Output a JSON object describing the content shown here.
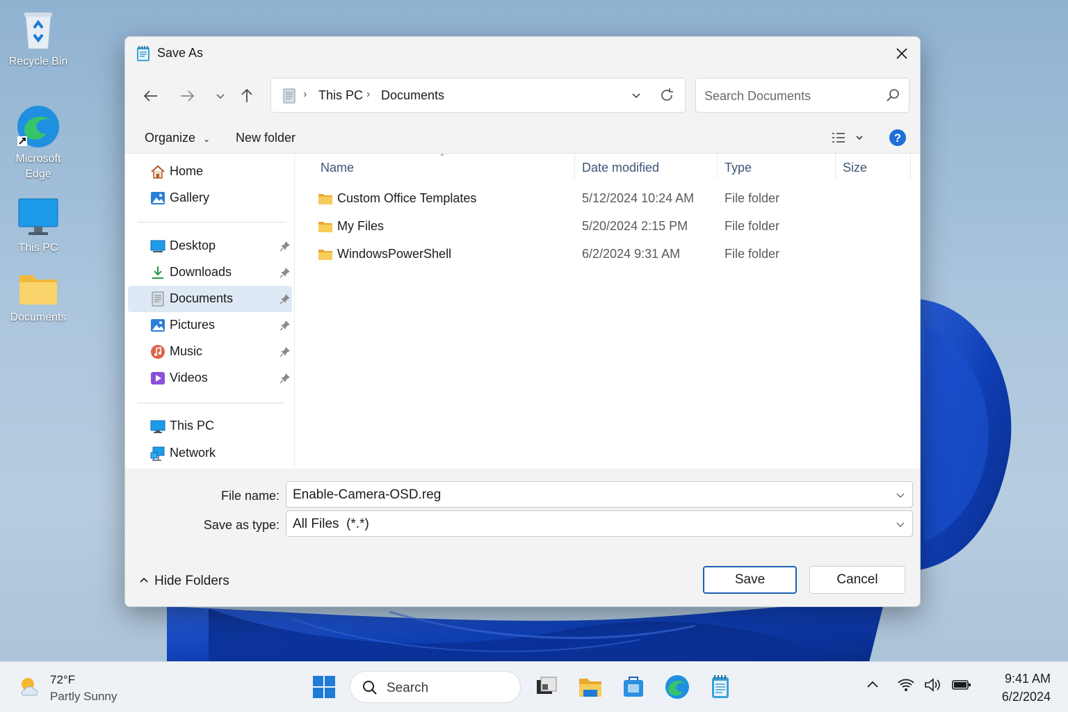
{
  "desktop": {
    "icons": [
      {
        "label": "Recycle Bin"
      },
      {
        "label": "Microsoft Edge"
      },
      {
        "label": "This PC"
      },
      {
        "label": "Documents"
      }
    ]
  },
  "dialog": {
    "title": "Save As",
    "nav": {
      "back": "back-arrow",
      "forward": "forward-arrow",
      "recent": "chevron-down",
      "up": "up-arrow"
    },
    "breadcrumb": [
      "This PC",
      "Documents"
    ],
    "search_placeholder": "Search Documents",
    "commands": {
      "organize": "Organize",
      "new_folder": "New folder"
    },
    "sidebar": {
      "group1": [
        {
          "label": "Home",
          "icon": "home-icon"
        },
        {
          "label": "Gallery",
          "icon": "gallery-icon"
        }
      ],
      "group2": [
        {
          "label": "Desktop",
          "icon": "desktop-icon",
          "pinned": true
        },
        {
          "label": "Downloads",
          "icon": "downloads-icon",
          "pinned": true
        },
        {
          "label": "Documents",
          "icon": "documents-icon",
          "pinned": true,
          "selected": true
        },
        {
          "label": "Pictures",
          "icon": "pictures-icon",
          "pinned": true
        },
        {
          "label": "Music",
          "icon": "music-icon",
          "pinned": true
        },
        {
          "label": "Videos",
          "icon": "videos-icon",
          "pinned": true
        }
      ],
      "group3": [
        {
          "label": "This PC",
          "icon": "this-pc-icon"
        },
        {
          "label": "Network",
          "icon": "network-icon"
        }
      ]
    },
    "columns": {
      "name": "Name",
      "date": "Date modified",
      "type": "Type",
      "size": "Size"
    },
    "files": [
      {
        "name": "Custom Office Templates",
        "date": "5/12/2024 10:24 AM",
        "type": "File folder"
      },
      {
        "name": "My Files",
        "date": "5/20/2024 2:15 PM",
        "type": "File folder"
      },
      {
        "name": "WindowsPowerShell",
        "date": "6/2/2024 9:31 AM",
        "type": "File folder"
      }
    ],
    "file_name_label": "File name:",
    "file_name_value": "Enable-Camera-OSD.reg",
    "save_type_label": "Save as type:",
    "save_type_value": "All Files  (*.*)",
    "hide_folders": "Hide Folders",
    "save_button": "Save",
    "cancel_button": "Cancel"
  },
  "taskbar": {
    "weather": {
      "temp": "72°F",
      "desc": "Partly Sunny"
    },
    "search_label": "Search",
    "clock": {
      "time": "9:41 AM",
      "date": "6/2/2024"
    }
  },
  "colors": {
    "accent": "#1a5fb4",
    "selection": "#dfe9f5",
    "folder": "#f4c44e"
  }
}
